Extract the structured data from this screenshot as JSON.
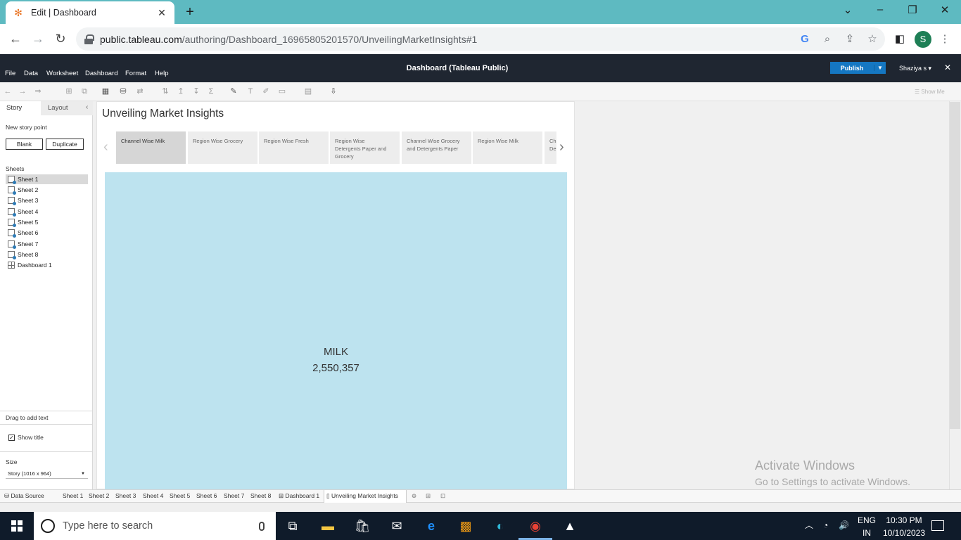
{
  "browser": {
    "tab_title": "Edit | Dashboard",
    "url_host": "public.tableau.com",
    "url_path": "/authoring/Dashboard_16965805201570/UnveilingMarketInsights#1",
    "profile_initial": "S"
  },
  "app": {
    "menu": [
      "File",
      "Data",
      "Worksheet",
      "Dashboard",
      "Format",
      "Help"
    ],
    "title": "Dashboard (Tableau Public)",
    "publish_label": "Publish",
    "user_name": "Shaziya s",
    "show_me": "Show Me"
  },
  "left_pane": {
    "tab_story": "Story",
    "tab_layout": "Layout",
    "new_story_point": "New story point",
    "blank_button": "Blank",
    "duplicate_button": "Duplicate",
    "sheets_heading": "Sheets",
    "sheets": [
      "Sheet 1",
      "Sheet 2",
      "Sheet 3",
      "Sheet 4",
      "Sheet 5",
      "Sheet 6",
      "Sheet 7",
      "Sheet 8"
    ],
    "dashboard_item": "Dashboard 1",
    "drag_to_add_text": "Drag to add text",
    "show_title": "Show title",
    "size_heading": "Size",
    "size_value": "Story (1016 x 964)"
  },
  "story": {
    "title": "Unveiling Market Insights",
    "story_points": [
      {
        "line1": "Channel Wise Milk",
        "line2": "",
        "line3": ""
      },
      {
        "line1": "Region Wise Grocery",
        "line2": "",
        "line3": ""
      },
      {
        "line1": "Region Wise Fresh",
        "line2": "",
        "line3": ""
      },
      {
        "line1": "Region Wise",
        "line2": "Detergents Paper and",
        "line3": "Grocery"
      },
      {
        "line1": "Channel Wise Grocery",
        "line2": "and Detergents Paper",
        "line3": ""
      },
      {
        "line1": "Region Wise Milk",
        "line2": "",
        "line3": ""
      },
      {
        "line1": "Cha",
        "line2": "De",
        "line3": ""
      }
    ],
    "viz_label": "MILK",
    "viz_value": "2,550,357",
    "viz_color": "#bde3ef"
  },
  "bottom_tabs": {
    "data_source": "Data Source",
    "sheets": [
      "Sheet 1",
      "Sheet 2",
      "Sheet 3",
      "Sheet 4",
      "Sheet 5",
      "Sheet 6",
      "Sheet 7",
      "Sheet 8"
    ],
    "dashboard": "Dashboard 1",
    "story": "Unveiling Market Insights"
  },
  "watermark": {
    "line1": "Activate Windows",
    "line2": "Go to Settings to activate Windows."
  },
  "taskbar": {
    "search_placeholder": "Type here to search",
    "lang_top": "ENG",
    "lang_bottom": "IN",
    "time": "10:30 PM",
    "date": "10/10/2023"
  }
}
